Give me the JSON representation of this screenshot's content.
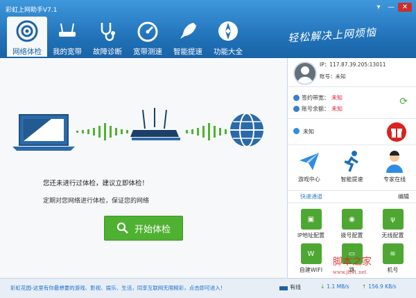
{
  "app": {
    "title": "彩虹上网助手V7.1"
  },
  "window": {
    "minimize": "▾",
    "restore": "—",
    "close": "✕"
  },
  "toolbar": [
    {
      "label": "网络体检",
      "icon": "target-icon",
      "active": true
    },
    {
      "label": "我的宽带",
      "icon": "router-icon"
    },
    {
      "label": "故障诊断",
      "icon": "stethoscope-icon"
    },
    {
      "label": "宽带测速",
      "icon": "speedometer-icon"
    },
    {
      "label": "智能提速",
      "icon": "rocket-icon"
    },
    {
      "label": "功能大全",
      "icon": "grid-icon"
    }
  ],
  "slogan": "轻松解决上网烦恼",
  "main": {
    "message": "您还未进行过体检，建议立即体检！",
    "submessage": "定期对您网络进行体检，保证您的网络",
    "start_button": "开始体检"
  },
  "sidebar": {
    "ip_label": "IP：",
    "ip_value": "117.87.39.205:13011",
    "account_label": "账号：",
    "account_value": "未知",
    "plan_label": "签约带宽：",
    "plan_value": "未知",
    "balance_label": "账号余额：",
    "balance_value": "未知",
    "promo": "未知",
    "services": [
      {
        "label": "游戏中心",
        "icon": "paper-plane-icon"
      },
      {
        "label": "智能提速",
        "icon": "runner-icon"
      },
      {
        "label": "专家在线",
        "icon": "expert-icon"
      }
    ],
    "quick_tab": "快速通道",
    "edit": "编辑",
    "quick": [
      {
        "label": "IP地址配置",
        "icon": "monitor-icon"
      },
      {
        "label": "拨号配置",
        "icon": "dialer-icon"
      },
      {
        "label": "无线配置",
        "icon": "antenna-icon"
      },
      {
        "label": "自建WIFI",
        "icon": "wifi-icon"
      },
      {
        "label": "路",
        "icon": "router-small-icon"
      },
      {
        "label": "机号",
        "icon": "wifi-phone-icon"
      }
    ]
  },
  "status": {
    "ad": "彩虹花园-这里有你最想要的游戏、影视、娱乐、生活，同享互联网无限精彩，点击即可进入！",
    "online": "有线",
    "down": "1.1 MB/s",
    "up": "156.9 KB/s"
  },
  "watermark": {
    "main": "脚本之家",
    "sub": "www.jb51.net"
  }
}
